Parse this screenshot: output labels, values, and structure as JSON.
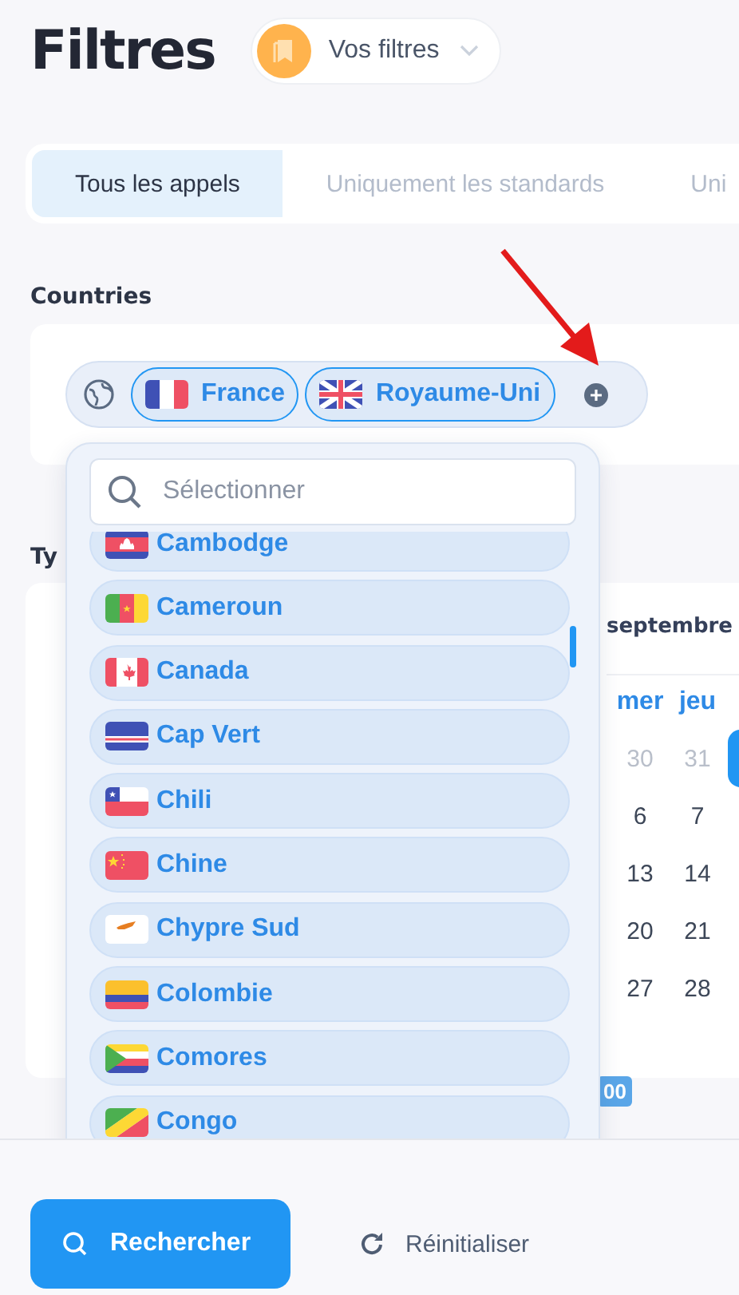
{
  "header": {
    "title": "Filtres",
    "saved_filters": {
      "label": "Vos filtres"
    }
  },
  "tabs": [
    {
      "label": "Tous les appels",
      "selected": true
    },
    {
      "label": "Uniquement les standards",
      "selected": false
    },
    {
      "label": "Uni",
      "selected": false
    }
  ],
  "countries": {
    "label": "Countries",
    "chips": [
      {
        "label": "France"
      },
      {
        "label": "Royaume-Uni"
      }
    ]
  },
  "dropdown": {
    "search": {
      "placeholder": "Sélectionner"
    },
    "options": [
      {
        "label": "Cambodge"
      },
      {
        "label": "Cameroun"
      },
      {
        "label": "Canada"
      },
      {
        "label": "Cap Vert"
      },
      {
        "label": "Chili"
      },
      {
        "label": "Chine"
      },
      {
        "label": "Chypre Sud"
      },
      {
        "label": "Colombie"
      },
      {
        "label": "Comores"
      },
      {
        "label": "Congo"
      }
    ]
  },
  "types": {
    "label": "Ty",
    "badge": "00",
    "calendar": {
      "month": "septembre",
      "columns": [
        {
          "heading": "mer",
          "days": [
            {
              "text": "30",
              "muted": true,
              "selected": false
            },
            {
              "text": "6",
              "muted": false,
              "selected": false
            },
            {
              "text": "13",
              "muted": false,
              "selected": false
            },
            {
              "text": "20",
              "muted": false,
              "selected": false
            },
            {
              "text": "27",
              "muted": false,
              "selected": false
            }
          ]
        },
        {
          "heading": "jeu",
          "days": [
            {
              "text": "31",
              "muted": true,
              "selected": false
            },
            {
              "text": "7",
              "muted": false,
              "selected": false
            },
            {
              "text": "14",
              "muted": false,
              "selected": false
            },
            {
              "text": "21",
              "muted": false,
              "selected": false
            },
            {
              "text": "28",
              "muted": false,
              "selected": false
            }
          ]
        },
        {
          "days": [
            {
              "selected": true
            }
          ]
        }
      ]
    }
  },
  "footer": {
    "buttons": [
      {
        "label": "Rechercher",
        "kind": "primary"
      },
      {
        "label": "Réinitialiser",
        "kind": "reset"
      }
    ]
  }
}
